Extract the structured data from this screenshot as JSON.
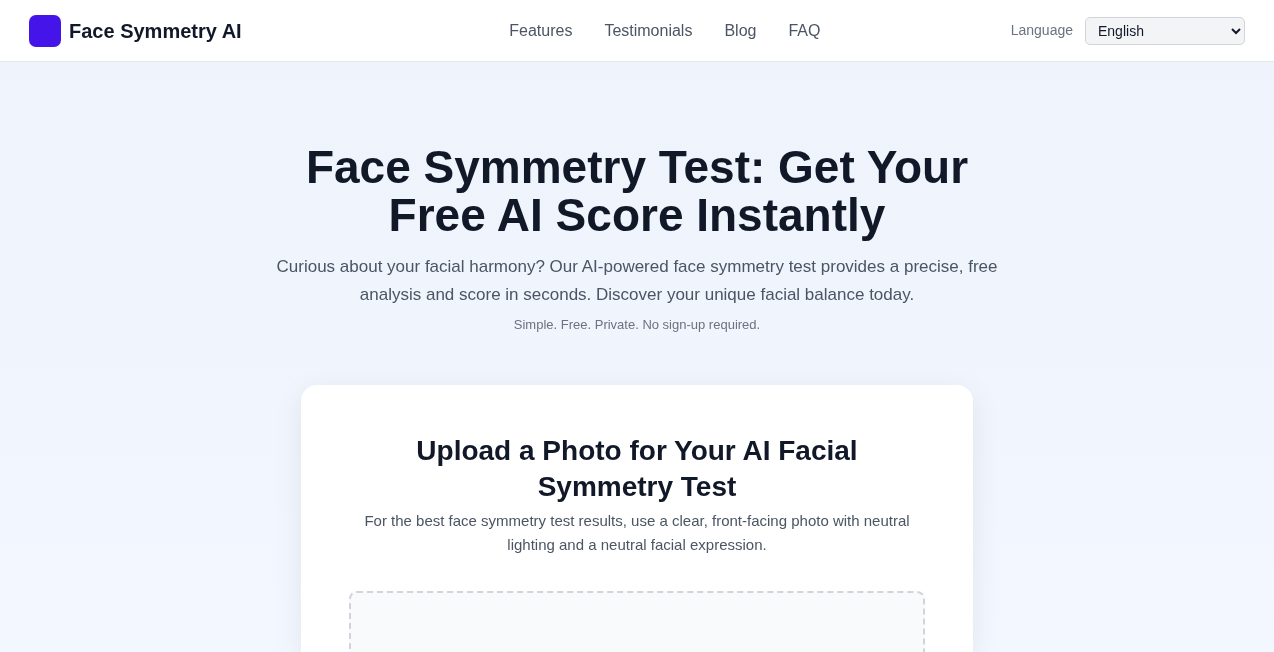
{
  "brand": {
    "name": "Face Symmetry AI"
  },
  "nav": [
    "Features",
    "Testimonials",
    "Blog",
    "FAQ"
  ],
  "language": {
    "label": "Language",
    "value": "English"
  },
  "hero": {
    "title": "Face Symmetry Test: Get Your Free AI Score Instantly",
    "subtitle": "Curious about your facial harmony? Our AI-powered face symmetry test provides a precise, free analysis and score in seconds. Discover your unique facial balance today.",
    "note": "Simple. Free. Private. No sign-up required."
  },
  "upload": {
    "title": "Upload a Photo for Your AI Facial Symmetry Test",
    "description": "For the best face symmetry test results, use a clear, front-facing photo with neutral lighting and a neutral facial expression."
  }
}
